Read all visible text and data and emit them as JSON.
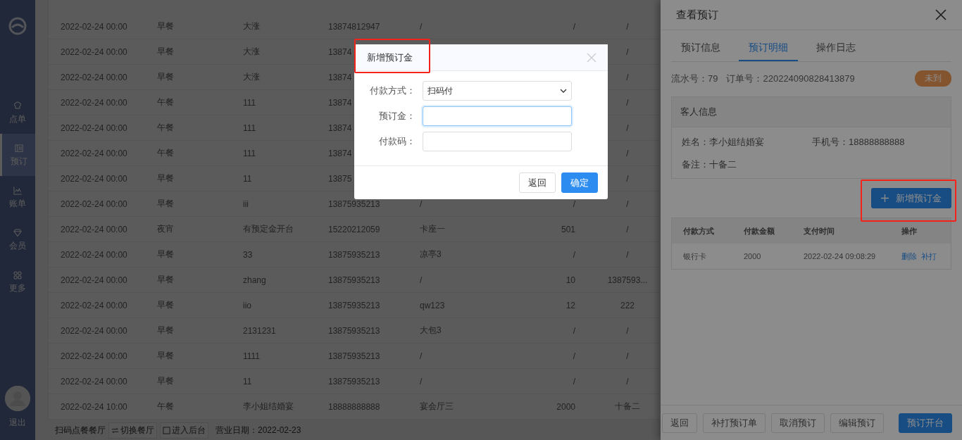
{
  "sidebar": {
    "items": [
      {
        "label": "点单",
        "selected": false
      },
      {
        "label": "预订",
        "selected": true
      },
      {
        "label": "账单",
        "selected": false
      },
      {
        "label": "会员",
        "selected": false
      },
      {
        "label": "更多",
        "selected": false
      }
    ],
    "logout": "退出"
  },
  "table": {
    "rows": [
      {
        "time": "2022-02-24 00:00",
        "meal": "早餐",
        "guest": "大涨",
        "phone": "13874812947",
        "column_5": "/",
        "column_6": "/",
        "column_7": "/"
      },
      {
        "time": "2022-02-24 00:00",
        "meal": "早餐",
        "guest": "大涨",
        "phone": "13874",
        "column_7": "/"
      },
      {
        "time": "2022-02-24 00:00",
        "meal": "早餐",
        "guest": "大涨",
        "phone": "13874",
        "column_7": "/"
      },
      {
        "time": "2022-02-24 00:00",
        "meal": "午餐",
        "guest": "111",
        "phone": "13874",
        "column_7": "/"
      },
      {
        "time": "2022-02-24 00:00",
        "meal": "午餐",
        "guest": "111",
        "phone": "13874",
        "column_7": "/"
      },
      {
        "time": "2022-02-24 00:00",
        "meal": "午餐",
        "guest": "111",
        "phone": "13874",
        "column_7": "/"
      },
      {
        "time": "2022-02-24 00:00",
        "meal": "早餐",
        "guest": "11",
        "phone": "13875",
        "column_7": "/"
      },
      {
        "time": "2022-02-24 00:00",
        "meal": "早餐",
        "guest": "iii",
        "phone": "13875935213",
        "column_5": "/",
        "column_6": "/",
        "column_7": "/"
      },
      {
        "time": "2022-02-24 00:00",
        "meal": "夜宵",
        "guest": "有预定金开台",
        "phone": "15220212059",
        "column_5": "卡座一",
        "column_6": "501",
        "column_7": "/"
      },
      {
        "time": "2022-02-24 00:00",
        "meal": "早餐",
        "guest": "33",
        "phone": "13875935213",
        "column_5": "凉亭3",
        "column_6": "/",
        "column_7": "/"
      },
      {
        "time": "2022-02-24 00:00",
        "meal": "早餐",
        "guest": "zhang",
        "phone": "13875935213",
        "column_5": "/",
        "column_6": "10",
        "column_7": "1387593..."
      },
      {
        "time": "2022-02-24 00:00",
        "meal": "早餐",
        "guest": "iio",
        "phone": "13875935213",
        "column_5": "qw123",
        "column_6": "12",
        "column_7": "222"
      },
      {
        "time": "2022-02-24 00:00",
        "meal": "早餐",
        "guest": "2131231",
        "phone": "13875935213",
        "column_5": "大包3",
        "column_6": "/",
        "column_7": "/"
      },
      {
        "time": "2022-02-24 00:00",
        "meal": "早餐",
        "guest": "1111",
        "phone": "13875935213",
        "column_5": "/",
        "column_6": "/",
        "column_7": "/"
      },
      {
        "time": "2022-02-24 00:00",
        "meal": "早餐",
        "guest": "11",
        "phone": "13875935213",
        "column_5": "/",
        "column_6": "/",
        "column_7": "/"
      },
      {
        "time": "2022-02-24 10:00",
        "meal": "午餐",
        "guest": "李小姐结婚宴",
        "phone": "18888888888",
        "column_5": "宴会厅三",
        "column_6": "2000",
        "column_7": "十备二"
      }
    ]
  },
  "bottom_bar": {
    "restaurant": "扫码点餐餐厅",
    "switch_button": "切换餐厅",
    "admin_button": "进入后台",
    "business_date": "营业日期：2022-02-23"
  },
  "drawer": {
    "title": "查看预订",
    "tabs": [
      {
        "label": "预订信息",
        "selected": false
      },
      {
        "label": "预订明细",
        "selected": true
      },
      {
        "label": "操作日志",
        "selected": false
      }
    ],
    "serial": "流水号：79",
    "order_no": "订单号：220224090828413879",
    "status_badge": "未到",
    "guest_card": {
      "title": "客人信息",
      "name": "姓名：李小姐结婚宴",
      "phone": "手机号：18888888888",
      "note": "备注：十备二"
    },
    "add_button": {
      "label": "新增预订金",
      "highlighted": true
    },
    "payments": {
      "columns": [
        "付款方式",
        "付款金额",
        "支付时间",
        "操作"
      ],
      "rows": [
        {
          "method": "银行卡",
          "amount": "2000",
          "time": "2022-02-24 09:08:29",
          "actions": [
            "删除",
            "补打"
          ]
        }
      ]
    },
    "footer_buttons": [
      {
        "label": "返回",
        "kind": "default"
      },
      {
        "label": "补打预订单",
        "kind": "default"
      },
      {
        "label": "取消预订",
        "kind": "default"
      },
      {
        "label": "编辑预订",
        "kind": "default"
      },
      {
        "label": "预订开台",
        "kind": "primary"
      }
    ]
  },
  "dialog": {
    "title": "新增预订金",
    "title_highlighted": true,
    "fields": [
      {
        "label": "付款方式：",
        "kind": "select",
        "value": "扫码付",
        "focused": false
      },
      {
        "label": "预订金：",
        "kind": "input",
        "focused": true
      },
      {
        "label": "付款码：",
        "kind": "input",
        "focused": false
      }
    ],
    "buttons": [
      {
        "label": "返回",
        "kind": "default"
      },
      {
        "label": "确定",
        "kind": "primary"
      }
    ]
  }
}
